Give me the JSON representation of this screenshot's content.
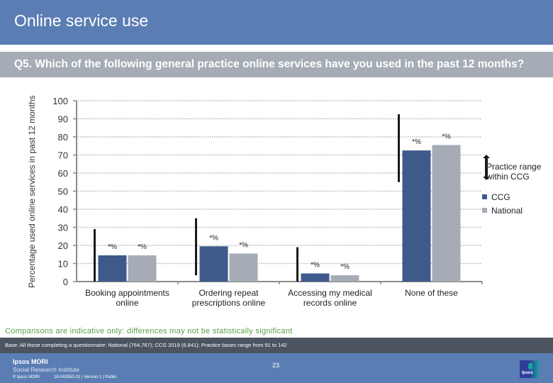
{
  "header": {
    "title": "Online service use"
  },
  "question": "Q5. Which of the following general practice online services have you used in the past 12 months?",
  "chart_data": {
    "type": "bar",
    "title": "",
    "xlabel": "",
    "ylabel": "Percentage used online services in past 12 months",
    "ylim": [
      0,
      100
    ],
    "yticks": [
      0,
      10,
      20,
      30,
      40,
      50,
      60,
      70,
      80,
      90,
      100
    ],
    "grid": true,
    "categories": [
      "Booking appointments online",
      "Ordering repeat prescriptions online",
      "Accessing my medical records online",
      "None of these"
    ],
    "category_lines": [
      [
        "Booking appointments",
        "online"
      ],
      [
        "Ordering repeat",
        "prescriptions online"
      ],
      [
        "Accessing my medical",
        "records online"
      ],
      [
        "None of these"
      ]
    ],
    "series": [
      {
        "name": "CCG",
        "color": "#3e5a8a",
        "values": [
          14.5,
          19.5,
          4.5,
          72.5
        ],
        "labels": [
          "*%",
          "*%",
          "*%",
          "*%"
        ]
      },
      {
        "name": "National",
        "color": "#a5acb5",
        "values": [
          14.5,
          15.5,
          3.5,
          75.5
        ],
        "labels": [
          "*%",
          "*%",
          "*%",
          "*%"
        ]
      }
    ],
    "practice_range": {
      "name": "Practice range within CCG",
      "min": [
        0,
        3.5,
        0,
        55
      ],
      "max": [
        29,
        35,
        19,
        92.5
      ]
    },
    "legend": {
      "placement": "right",
      "range_label": "Practice range within CCG",
      "items": [
        {
          "label": "CCG",
          "color": "#3e5a8a"
        },
        {
          "label": "National",
          "color": "#a5acb5"
        }
      ]
    }
  },
  "note": "Comparisons are indicative only: differences may not be statistically significant",
  "base": "Base: All those completing a questionnaire: National (764,767); CCG 2019 (6,841); Practice bases range from 91 to 142",
  "footer": {
    "brand": "Ipsos MORI",
    "brand_sub": "Social Research Institute",
    "copyright": "© Ipsos MORI",
    "docref": "18-042653-01 | Version 1 | Public",
    "page": "23",
    "logo_text": "Ipsos"
  }
}
